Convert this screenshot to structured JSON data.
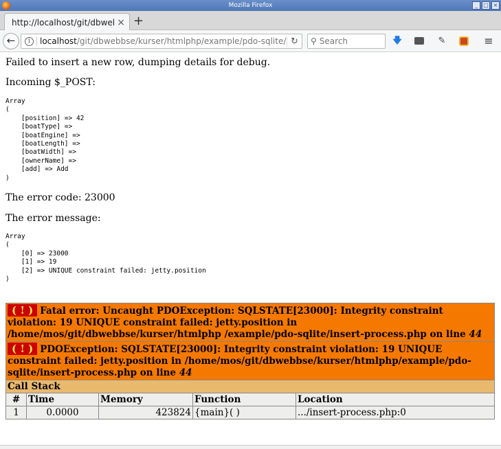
{
  "window": {
    "title": "Mozilla Firefox"
  },
  "tab": {
    "title": "http://localhost/git/dbwebb",
    "close": "×",
    "new_tab": "+"
  },
  "nav": {
    "back": "←",
    "url_host": "localhost",
    "url_path": "/git/dbwebbse/kurser/htmlphp/example/pdo-sqlite/ins",
    "reload": "↻",
    "search_placeholder": "Search"
  },
  "content": {
    "intro": "Failed to insert a new row, dumping details for debug.",
    "post_label": "Incoming $_POST:",
    "post_dump": "Array\n(\n    [position] => 42\n    [boatType] => \n    [boatEngine] => \n    [boatLength] => \n    [boatWidth] => \n    [ownerName] => \n    [add] => Add\n)",
    "error_code": "The error code: 23000",
    "error_message_label": "The error message:",
    "error_dump": "Array\n(\n    [0] => 23000\n    [1] => 19\n    [2] => UNIQUE constraint failed: jetty.position\n)"
  },
  "xdebug": {
    "marker": "( ! )",
    "fatal_text": "Fatal error: Uncaught PDOException: SQLSTATE[23000]: Integrity constraint violation: 19 UNIQUE constraint failed: jetty.position in /home/mos/git/dbwebbse/kurser/htmlphp /example/pdo-sqlite/insert-process.php on line ",
    "fatal_line": "44",
    "exception_text": "PDOException: SQLSTATE[23000]: Integrity constraint violation: 19 UNIQUE constraint failed: jetty.position in /home/mos/git/dbwebbse/kurser/htmlphp/example/pdo-sqlite/insert-process.php on line ",
    "exception_line": "44",
    "call_stack": "Call Stack",
    "columns": {
      "num": "#",
      "time": "Time",
      "memory": "Memory",
      "function": "Function",
      "location": "Location"
    },
    "rows": [
      {
        "num": "1",
        "time": "0.0000",
        "memory": "423824",
        "function": "{main}( )",
        "location": ".../insert-process.php:0"
      }
    ]
  }
}
